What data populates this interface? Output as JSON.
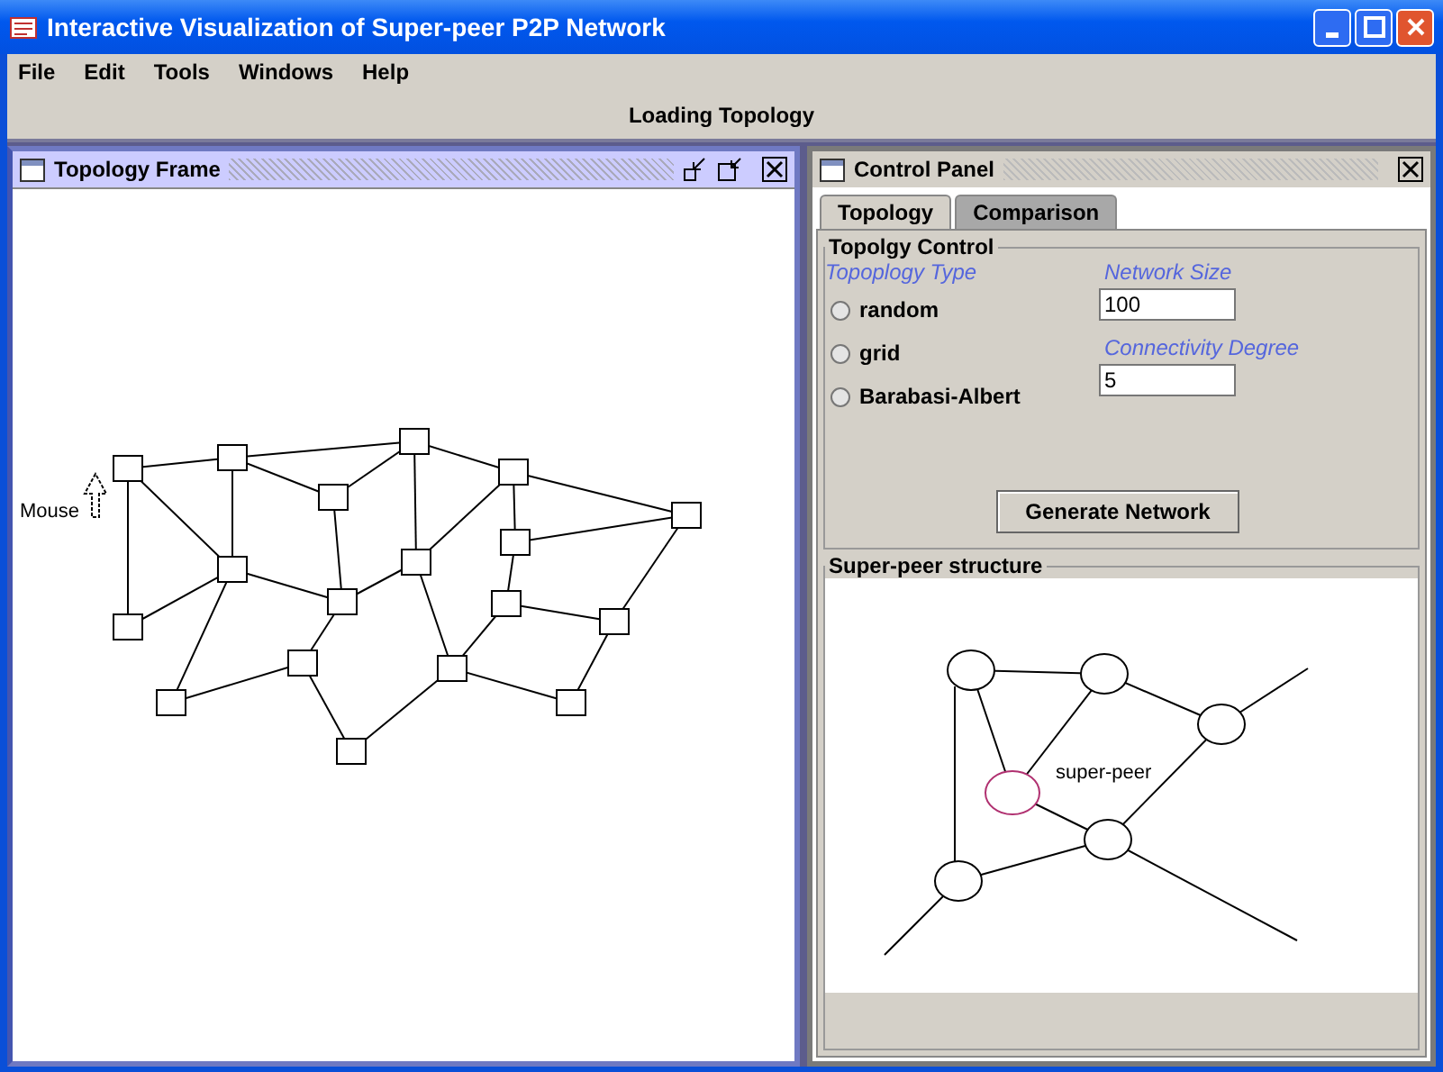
{
  "window": {
    "title": "Interactive Visualization of Super-peer P2P Network"
  },
  "menu": [
    "File",
    "Edit",
    "Tools",
    "Windows",
    "Help"
  ],
  "status": "Loading Topology",
  "topology_frame": {
    "title": "Topology Frame",
    "mouse_label": "Mouse"
  },
  "control_panel": {
    "title": "Control Panel",
    "tabs": [
      {
        "label": "Topology",
        "selected": true
      },
      {
        "label": "Comparison",
        "selected": false
      }
    ],
    "group_title": "Topolgy Control",
    "type_label": "Topoplogy Type",
    "radios": [
      {
        "label": "random",
        "selected": false
      },
      {
        "label": "grid",
        "selected": false
      },
      {
        "label": "Barabasi-Albert",
        "selected": false
      }
    ],
    "network_size_label": "Network Size",
    "network_size": "100",
    "connectivity_label": "Connectivity Degree",
    "connectivity": "5",
    "button": "Generate Network",
    "structure_title": "Super-peer structure",
    "super_peer_label": "super-peer"
  }
}
